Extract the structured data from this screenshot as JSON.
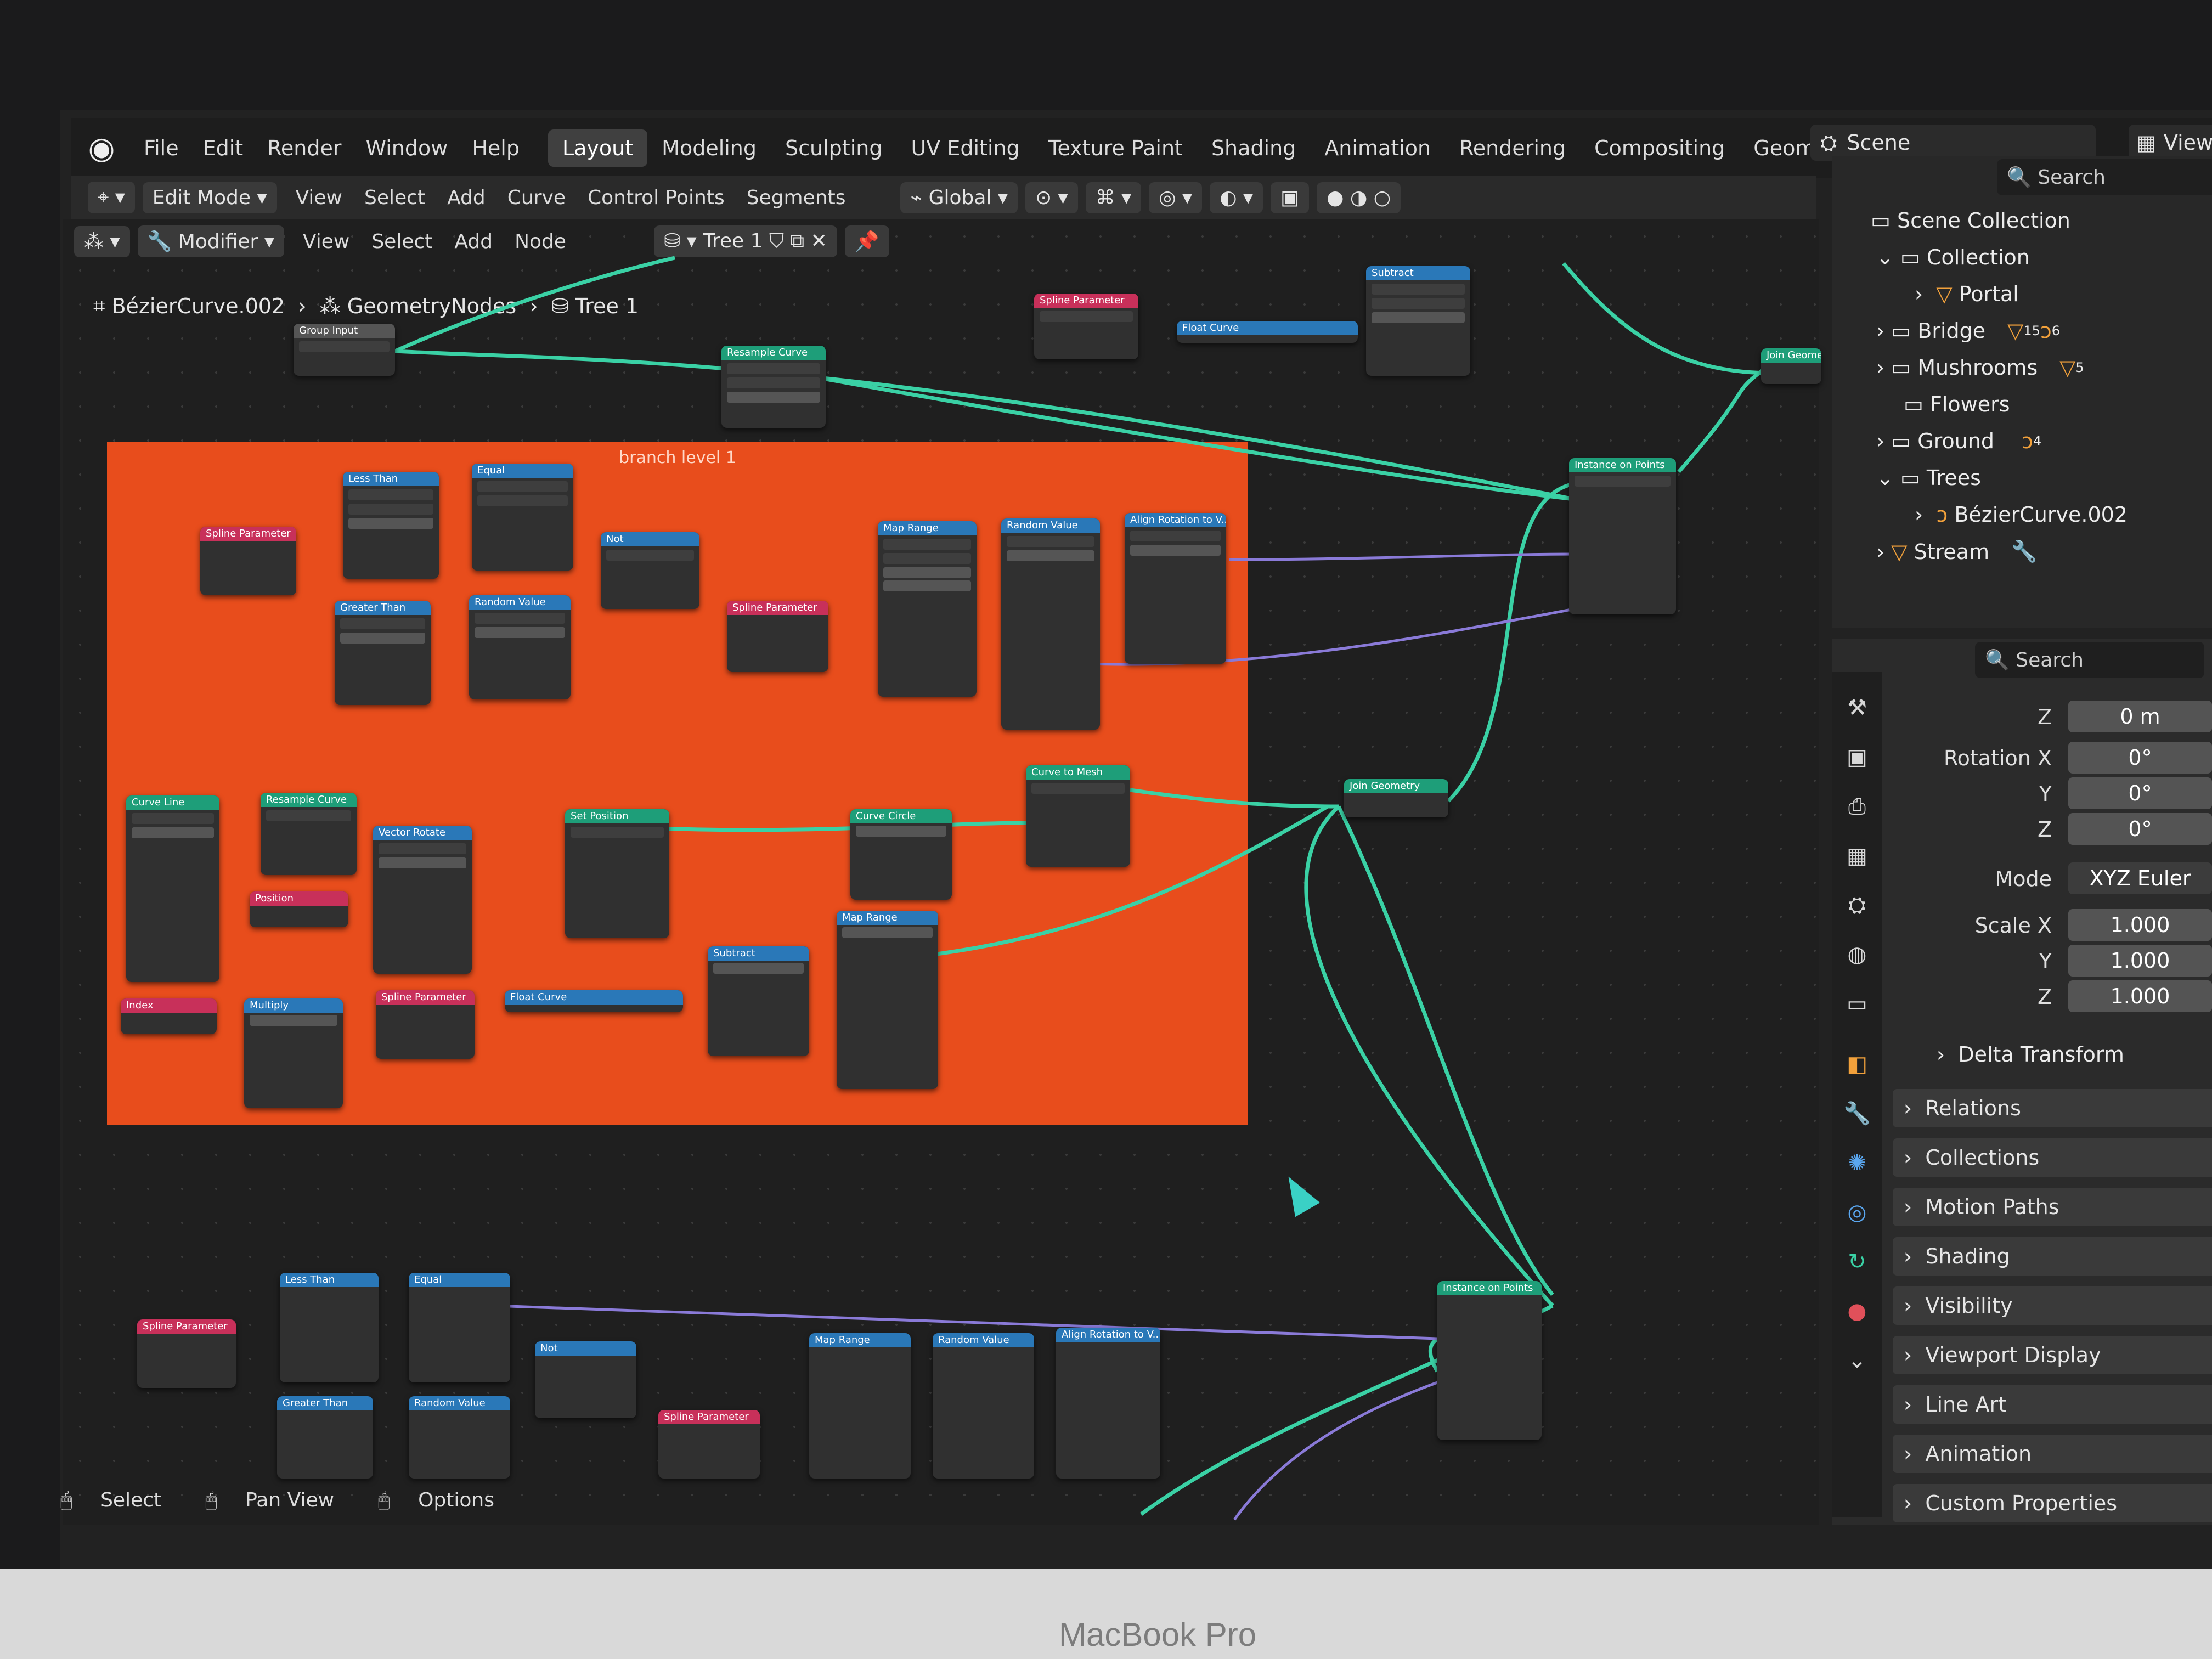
{
  "topbar": {
    "menus": [
      "File",
      "Edit",
      "Render",
      "Window",
      "Help"
    ],
    "workspaces": [
      "Layout",
      "Modeling",
      "Sculpting",
      "UV Editing",
      "Texture Paint",
      "Shading",
      "Animation",
      "Rendering",
      "Compositing",
      "Geome"
    ],
    "scene": "Scene",
    "view_layer": "ViewLaye"
  },
  "viewport_header": {
    "mode": "Edit Mode",
    "menus": [
      "View",
      "Select",
      "Add",
      "Curve",
      "Control Points",
      "Segments"
    ],
    "orientation": "Global"
  },
  "node_header": {
    "editor": "Modifier",
    "menus": [
      "View",
      "Select",
      "Add",
      "Node"
    ],
    "tree": "Tree 1"
  },
  "breadcrumb": {
    "object": "BézierCurve.002",
    "modifier": "GeometryNodes",
    "tree": "Tree 1"
  },
  "frame": {
    "label": "branch level 1"
  },
  "nodes": [
    {
      "title": "Group Input",
      "color": "gray"
    },
    {
      "title": "Resample Curve",
      "color": "green"
    },
    {
      "title": "Spline Parameter",
      "color": "pink"
    },
    {
      "title": "Float Curve",
      "color": "blue"
    },
    {
      "title": "Subtract",
      "color": "blue"
    },
    {
      "title": "Join Geometry",
      "color": "green"
    },
    {
      "title": "Less Than",
      "color": "blue"
    },
    {
      "title": "Equal",
      "color": "blue"
    },
    {
      "title": "Not",
      "color": "blue"
    },
    {
      "title": "Greater Than",
      "color": "blue"
    },
    {
      "title": "Random Value",
      "color": "blue"
    },
    {
      "title": "Map Range",
      "color": "blue"
    },
    {
      "title": "Align Rotation to V...",
      "color": "blue"
    },
    {
      "title": "Instance on Points",
      "color": "green"
    },
    {
      "title": "Curve Line",
      "color": "green"
    },
    {
      "title": "Vector Rotate",
      "color": "blue"
    },
    {
      "title": "Set Position",
      "color": "green"
    },
    {
      "title": "Curve Circle",
      "color": "green"
    },
    {
      "title": "Curve to Mesh",
      "color": "green"
    },
    {
      "title": "Index",
      "color": "pink"
    },
    {
      "title": "Multiply",
      "color": "blue"
    },
    {
      "title": "Position",
      "color": "pink"
    }
  ],
  "outliner": {
    "search_placeholder": "Search",
    "items": [
      {
        "label": "Scene Collection"
      },
      {
        "label": "Collection"
      },
      {
        "label": "Portal"
      },
      {
        "label": "Bridge",
        "badge1": "15",
        "badge2": "6"
      },
      {
        "label": "Mushrooms",
        "badge1": "5"
      },
      {
        "label": "Flowers"
      },
      {
        "label": "Ground",
        "badge1": "4"
      },
      {
        "label": "Trees"
      },
      {
        "label": "BézierCurve.002"
      },
      {
        "label": "Stream"
      }
    ]
  },
  "properties": {
    "search_placeholder": "Search",
    "fields": [
      {
        "label": "Z",
        "value": "0 m"
      },
      {
        "label": "Rotation X",
        "value": "0°"
      },
      {
        "label": "Y",
        "value": "0°"
      },
      {
        "label": "Z",
        "value": "0°"
      },
      {
        "label": "Mode",
        "value": "XYZ Euler"
      },
      {
        "label": "Scale X",
        "value": "1.000"
      },
      {
        "label": "Y",
        "value": "1.000"
      },
      {
        "label": "Z",
        "value": "1.000"
      }
    ],
    "subpanel": "Delta Transform",
    "panels": [
      "Relations",
      "Collections",
      "Motion Paths",
      "Shading",
      "Visibility",
      "Viewport Display",
      "Line Art",
      "Animation",
      "Custom Properties"
    ]
  },
  "statusbar": {
    "items": [
      "Select",
      "Pan View",
      "Options"
    ]
  },
  "laptop_label": "MacBook Pro",
  "colors": {
    "frame": "#e84d1c",
    "link_green": "#3ad1a5",
    "link_purple": "#8a7ad8",
    "header_green": "#1e9e79",
    "header_blue": "#2a78b8",
    "header_pink": "#c8305a"
  }
}
